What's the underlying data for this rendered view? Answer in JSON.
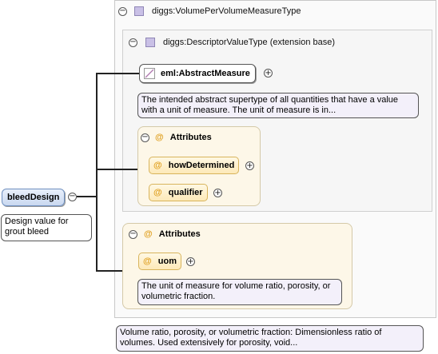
{
  "root": {
    "name": "bleedDesign",
    "doc": "Design value for grout bleed",
    "doc_line1": "Design value for",
    "doc_line2": "grout bleed"
  },
  "type": {
    "name": "diggs:VolumePerVolumeMeasureType",
    "doc_line1": "Volume ratio, porosity, or volumetric fraction: Dimensionless ratio of",
    "doc_line2": "volumes. Used extensively for porosity, void..."
  },
  "base_type": {
    "name": "diggs:DescriptorValueType (extension base)"
  },
  "abstract_measure": {
    "name": "eml:AbstractMeasure",
    "doc_line1": "The intended abstract supertype of all quantities that have a value",
    "doc_line2": "with a unit of measure. The unit of measure is in..."
  },
  "inner_attributes": {
    "title": "Attributes",
    "items": [
      {
        "name": "howDetermined"
      },
      {
        "name": "qualifier"
      }
    ]
  },
  "outer_attributes": {
    "title": "Attributes",
    "items": [
      {
        "name": "uom"
      }
    ],
    "uom_doc_line1": "The unit of measure for volume ratio, porosity, or",
    "uom_doc_line2": "volumetric fraction."
  },
  "symbols": {
    "collapse": "⊖",
    "expand": "⊕",
    "attribute": "@"
  },
  "colors": {
    "type_icon": "#c9c0e6",
    "attr_fill": "#fde9b8",
    "doc_fill": "#f3f0fa",
    "root_fill": "#c9d8f0"
  }
}
